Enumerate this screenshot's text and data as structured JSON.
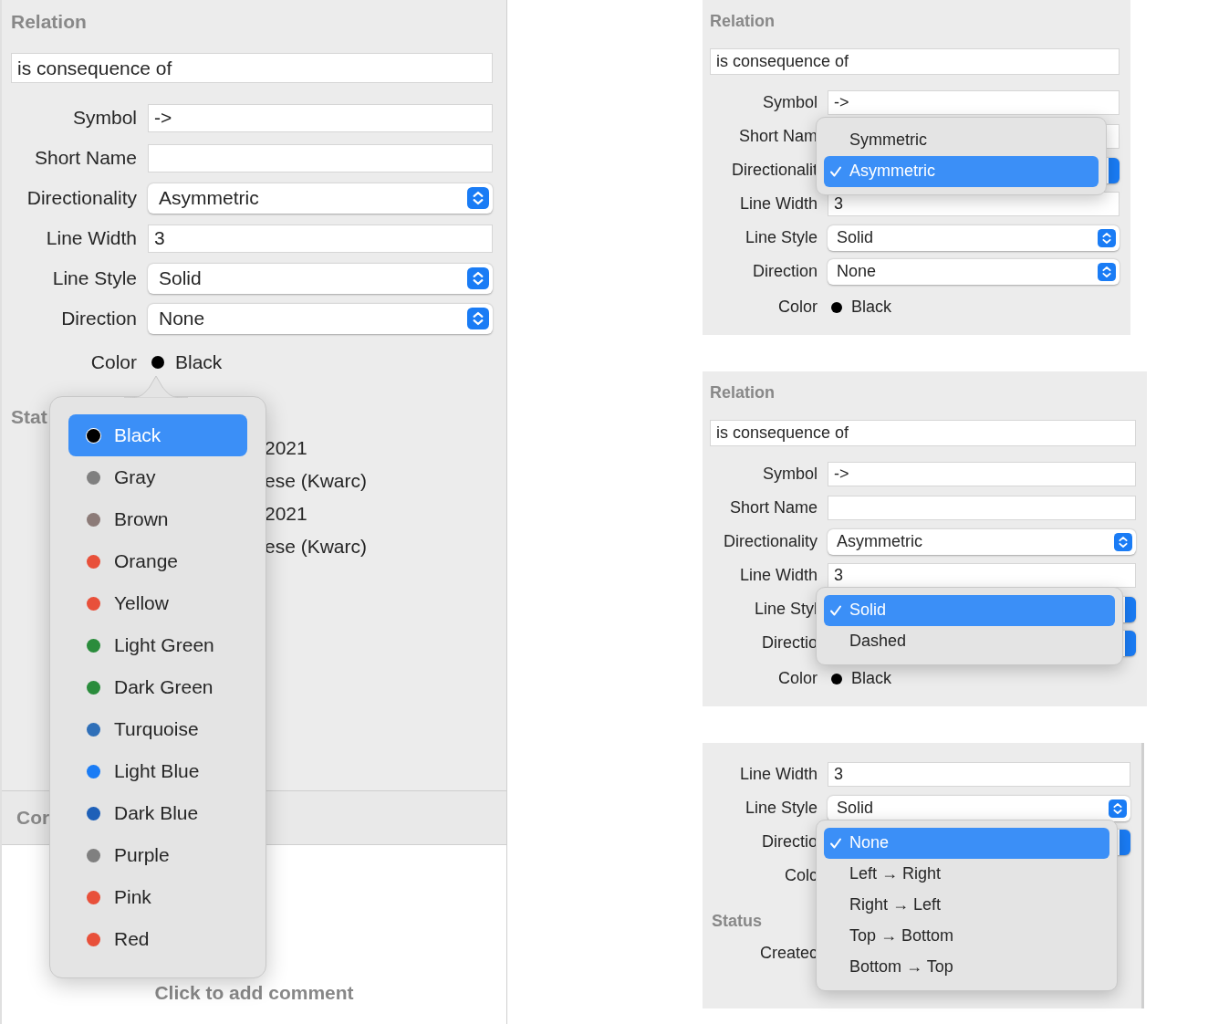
{
  "inspector": {
    "header": "Relation",
    "name": "is consequence of",
    "fields": [
      {
        "kind": "text",
        "label": "Symbol",
        "value": "->"
      },
      {
        "kind": "text",
        "label": "Short Name"
      },
      {
        "kind": "select",
        "label": "Directionality",
        "value": "Asymmetric"
      },
      {
        "kind": "text",
        "label": "Line Width",
        "value": "3"
      },
      {
        "kind": "select",
        "label": "Line Style",
        "value": "Solid"
      },
      {
        "kind": "select",
        "label": "Direction",
        "value": "None"
      },
      {
        "kind": "color",
        "label": "Color",
        "value": "Black",
        "color": "#000000",
        "menu": {
          "items": [
            {
              "label": "Black",
              "color": "#000000",
              "selected": true
            },
            {
              "label": "Gray",
              "color": "#808080",
              "selected": false
            },
            {
              "label": "Brown",
              "color": "#8c7b78",
              "selected": false
            },
            {
              "label": "Orange",
              "color": "#e8503a",
              "selected": false
            },
            {
              "label": "Yellow",
              "color": "#e8503a",
              "selected": false
            },
            {
              "label": "Light Green",
              "color": "#2a8c3c",
              "selected": false
            },
            {
              "label": "Dark Green",
              "color": "#2a8c3c",
              "selected": false
            },
            {
              "label": "Turquoise",
              "color": "#2f6fb8",
              "selected": false
            },
            {
              "label": "Light Blue",
              "color": "#1a7cf5",
              "selected": false
            },
            {
              "label": "Dark Blue",
              "color": "#1e60b8",
              "selected": false
            },
            {
              "label": "Purple",
              "color": "#808080",
              "selected": false
            },
            {
              "label": "Pink",
              "color": "#e8503a",
              "selected": false
            },
            {
              "label": "Red",
              "color": "#e8503a",
              "selected": false
            }
          ]
        }
      }
    ],
    "status": {
      "header": "Stat",
      "values": [
        "2021",
        "ese (Kwarc)",
        "2021",
        "ese (Kwarc)"
      ]
    },
    "comment": {
      "header": "Cor",
      "placeholder": "Click to add comment"
    }
  },
  "previews": [
    {
      "header": "Relation",
      "name": "is consequence of",
      "fields": [
        {
          "kind": "text",
          "label": "Symbol",
          "value": "->"
        },
        {
          "kind": "text",
          "label": "Short Nam"
        },
        {
          "kind": "select",
          "label": "Directionalit",
          "menu": {
            "items": [
              {
                "label": "Symmetric",
                "selected": false
              },
              {
                "label": "Asymmetric",
                "selected": true
              }
            ]
          }
        },
        {
          "kind": "text",
          "label": "Line Width",
          "value": "3"
        },
        {
          "kind": "select",
          "label": "Line Style",
          "value": "Solid"
        },
        {
          "kind": "select",
          "label": "Direction",
          "value": "None"
        },
        {
          "kind": "color",
          "label": "Color",
          "value": "Black",
          "color": "#000000"
        }
      ]
    },
    {
      "header": "Relation",
      "name": "is consequence of",
      "fields": [
        {
          "kind": "text",
          "label": "Symbol",
          "value": "->"
        },
        {
          "kind": "text",
          "label": "Short Name"
        },
        {
          "kind": "select",
          "label": "Directionality",
          "value": "Asymmetric"
        },
        {
          "kind": "text",
          "label": "Line Width",
          "value": "3"
        },
        {
          "kind": "select",
          "label": "Line Styl",
          "menu": {
            "items": [
              {
                "label": "Solid",
                "selected": true
              },
              {
                "label": "Dashed",
                "selected": false
              }
            ]
          }
        },
        {
          "kind": "select",
          "label": "Directio"
        },
        {
          "kind": "color",
          "label": "Color",
          "value": "Black",
          "color": "#000000"
        }
      ]
    },
    {
      "fields": [
        {
          "kind": "text",
          "label": "Line Width",
          "value": "3"
        },
        {
          "kind": "select",
          "label": "Line Style",
          "value": "Solid"
        },
        {
          "kind": "select",
          "label": "Directio",
          "menu": {
            "items": [
              {
                "label": "None",
                "selected": true
              },
              {
                "label": "Left → Right",
                "selected": false
              },
              {
                "label": "Right → Left",
                "selected": false
              },
              {
                "label": "Top → Bottom",
                "selected": false
              },
              {
                "label": "Bottom → Top",
                "selected": false
              }
            ]
          }
        },
        {
          "kind": "label",
          "label": "Colc"
        },
        {
          "kind": "section",
          "label": "Status"
        },
        {
          "kind": "label",
          "label": "Createc"
        }
      ]
    }
  ]
}
